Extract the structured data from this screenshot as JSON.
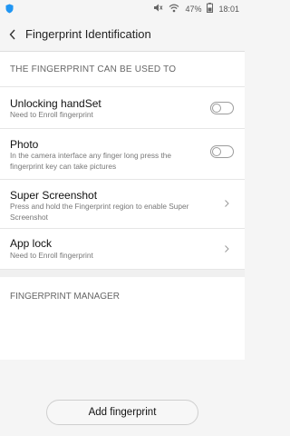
{
  "statusbar": {
    "battery": "47%",
    "time": "18:01"
  },
  "appbar": {
    "title": "Fingerprint Identification"
  },
  "section1": {
    "label": "THE FINGERPRINT CAN BE USED TO"
  },
  "items": [
    {
      "title": "Unlocking handSet",
      "subtitle": "Need to Enroll fingerprint",
      "control": "toggle",
      "enabled": false
    },
    {
      "title": "Photo",
      "subtitle": "In the camera interface any finger long press the fingerprint key can take pictures",
      "control": "toggle",
      "enabled": false
    },
    {
      "title": "Super Screenshot",
      "subtitle": "Press and hold the Fingerprint region to enable Super Screenshot",
      "control": "chevron"
    },
    {
      "title": "App lock",
      "subtitle": "Need to Enroll fingerprint",
      "control": "chevron"
    }
  ],
  "section2": {
    "label": "FINGERPRINT MANAGER"
  },
  "bottom": {
    "button_label": "Add fingerprint"
  }
}
